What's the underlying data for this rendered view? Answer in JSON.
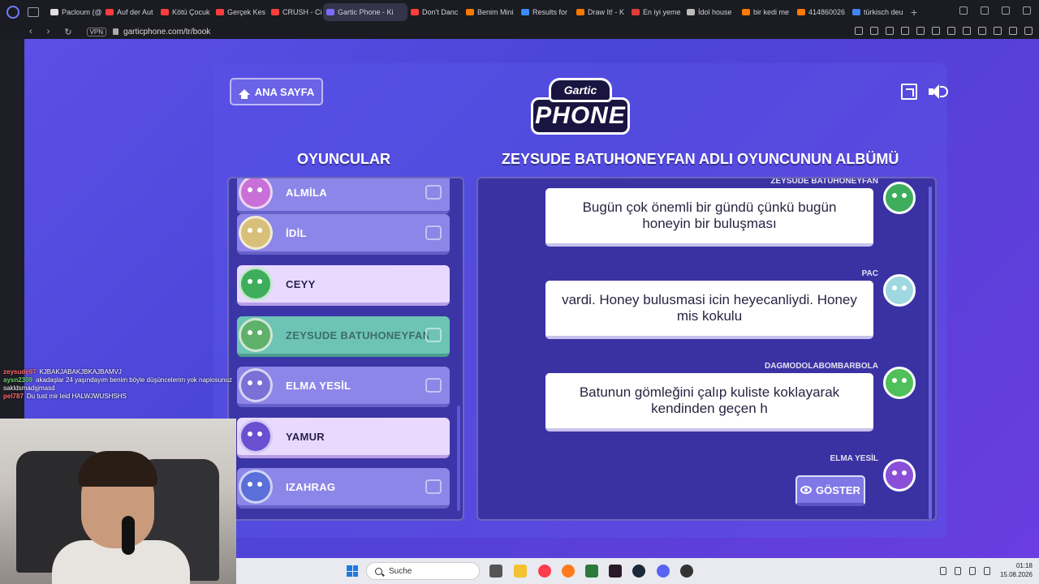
{
  "browser": {
    "tabs": [
      {
        "label": "Pacloum (@",
        "color": "#e0e0e0"
      },
      {
        "label": "Auf der Aut",
        "color": "#ff3d3d"
      },
      {
        "label": "Kötü Çocuk",
        "color": "#ff3d3d"
      },
      {
        "label": "Gerçek Kes",
        "color": "#ff3d3d"
      },
      {
        "label": "CRUSH - Ci",
        "color": "#ff3d3d"
      },
      {
        "label": "Gartic Phone - Ki",
        "color": "#7b6cff",
        "active": true
      },
      {
        "label": "Don't Danc",
        "color": "#ff3d3d"
      },
      {
        "label": "Benim Mini",
        "color": "#ff7a00"
      },
      {
        "label": "Results for",
        "color": "#3b8cff"
      },
      {
        "label": "Draw It! - K",
        "color": "#ff7a00"
      },
      {
        "label": "En iyi yeme",
        "color": "#e23b3b"
      },
      {
        "label": "İdol house",
        "color": "#bbbbbb"
      },
      {
        "label": "bir kedi me",
        "color": "#ff7a00"
      },
      {
        "label": "414860026",
        "color": "#ff7a00"
      },
      {
        "label": "türkisch deu",
        "color": "#4285f4"
      }
    ],
    "vpn_label": "VPN",
    "url": "garticphone.com/tr/book"
  },
  "game": {
    "home_label": "ANA SAYFA",
    "logo_top": "Gartic",
    "logo_bottom": "PHONE",
    "players_title": "OYUNCULAR",
    "album_title": "ZEYSUDE BATUHONEYFAN ADLI OYUNCUNUN ALBÜMÜ",
    "players": [
      {
        "name": "ALMİLA",
        "state": "normal",
        "avatar": "#c86fd8"
      },
      {
        "name": "İDİL",
        "state": "normal",
        "avatar": "#d8c07a"
      },
      {
        "name": "CEYY",
        "state": "highlight",
        "avatar": "#3fae5c"
      },
      {
        "name": "ZEYSUDE BATUHONEYFAN",
        "state": "current",
        "avatar": "#5fb06a"
      },
      {
        "name": "ELMA YESİL",
        "state": "normal",
        "avatar": "#7b6fd8"
      },
      {
        "name": "YAMUR",
        "state": "highlight",
        "avatar": "#6a4fd0"
      },
      {
        "name": "IZAHRAG",
        "state": "normal",
        "avatar": "#5a6fd8"
      }
    ],
    "album": [
      {
        "author": "ZEYSUDE BATUHONEYFAN",
        "text": "Bugün çok önemli bir gündü çünkü bugün honeyin bir buluşması",
        "avatar": "#3fae5c"
      },
      {
        "author": "PAC",
        "text": "vardi. Honey bulusmasi icin heyecanliydi. Honey mis kokulu",
        "avatar": "#9fd8e0"
      },
      {
        "author": "DAGMODOLABOMBARBOLA",
        "text": "Batunun gömleğini çalıp kuliste koklayarak kendinden geçen h",
        "avatar": "#4fc05a"
      },
      {
        "author": "ELMA YESİL",
        "text": "",
        "avatar": "#8a4fd8"
      }
    ],
    "show_label": "GÖSTER"
  },
  "chat": [
    {
      "user": "zeysude97",
      "text": "KJBAKJABAKJBKAJBAMVJ",
      "color": "#ff6b6b"
    },
    {
      "user": "aysn2309",
      "text": "akadaşlar 24 yaşındayım benim böyle düşüncelerim yok napiosunuz",
      "color": "#6bd56b"
    },
    {
      "user": "",
      "text": "sakldsmadşjmasd",
      "color": "#ffffff"
    },
    {
      "user": "pel787",
      "text": "Du tust mir leid HALWJWUSHSHS",
      "color": "#ff6b6b"
    }
  ],
  "taskbar": {
    "search_label": "Suche",
    "time": "01:18",
    "date": "15.08.2026"
  }
}
